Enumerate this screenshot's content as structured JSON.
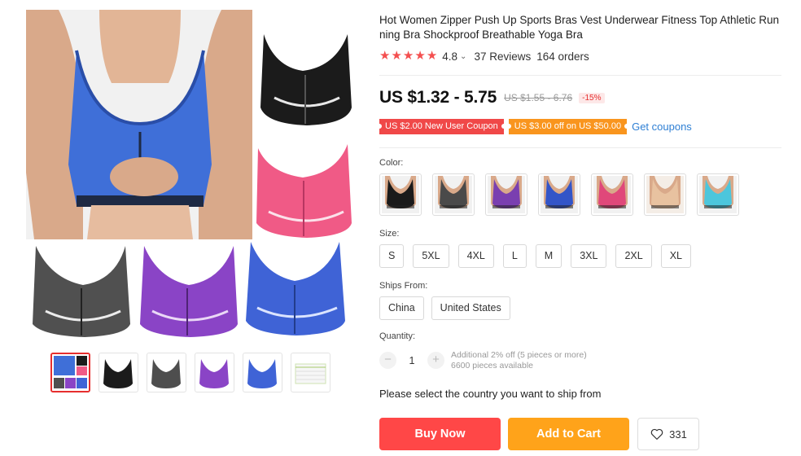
{
  "product": {
    "title": "Hot Women Zipper Push Up Sports Bras Vest Underwear Fitness Top Athletic Running Bra Shockproof Breathable Yoga Bra",
    "rating": "4.8",
    "reviews": "37 Reviews",
    "orders": "164 orders",
    "stars": 5,
    "star_color": "#f44f4f"
  },
  "price": {
    "current": "US $1.32 - 5.75",
    "original": "US $1.55 - 6.76",
    "discount": "-15%"
  },
  "coupons": {
    "new_user": "US $2.00 New User Coupon",
    "store": "US $3.00 off on US $50.00",
    "link": "Get coupons"
  },
  "options": {
    "color_label": "Color:",
    "colors": [
      {
        "name": "black",
        "hex": "#1a1a1a"
      },
      {
        "name": "gray",
        "hex": "#4a4a4a"
      },
      {
        "name": "purple",
        "hex": "#7a3fb0"
      },
      {
        "name": "blue",
        "hex": "#3355c8"
      },
      {
        "name": "rose",
        "hex": "#e0487a"
      },
      {
        "name": "nude",
        "hex": "#e8c2a0"
      },
      {
        "name": "sky",
        "hex": "#4cc6dc"
      }
    ],
    "size_label": "Size:",
    "sizes": [
      "S",
      "5XL",
      "4XL",
      "L",
      "M",
      "3XL",
      "2XL",
      "XL"
    ],
    "ships_label": "Ships From:",
    "ships_from": [
      "China",
      "United States"
    ]
  },
  "quantity": {
    "label": "Quantity:",
    "value": "1",
    "minus": "−",
    "plus": "+",
    "note1": "Additional 2% off (5 pieces or more)",
    "note2": "6600 pieces available"
  },
  "ship_message": "Please select the country you want to ship from",
  "actions": {
    "buy": "Buy Now",
    "cart": "Add to Cart",
    "wishlist_count": "331"
  },
  "gallery": {
    "thumbnails": [
      "collage",
      "black",
      "gray",
      "purple",
      "blue",
      "size-chart"
    ]
  }
}
